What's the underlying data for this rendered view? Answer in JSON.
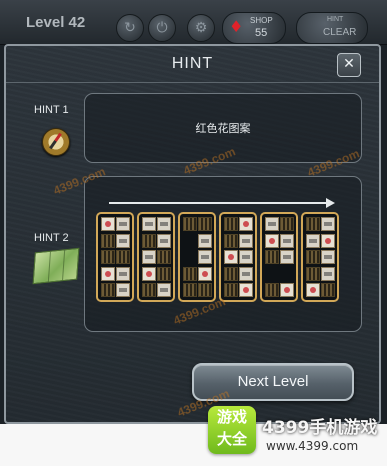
{
  "topbar": {
    "level_label": "Level 42",
    "shop_label": "SHOP",
    "shop_count": "55",
    "clear_top": "HINT",
    "clear_bottom": "CLEAR"
  },
  "dialog": {
    "title": "HINT",
    "close_glyph": "✕",
    "hint1": {
      "label": "HINT 1",
      "icon": "compass-icon",
      "text": "红色花图案"
    },
    "hint2": {
      "label": "HINT 2",
      "icon": "map-icon"
    },
    "next_button": "Next Level"
  },
  "footer": {
    "logo_line1": "游戏",
    "logo_line2": "大全",
    "brand": "4399手机游戏",
    "url": "www.4399.com"
  },
  "watermark": "4399.com",
  "colors": {
    "accent": "#d2a858",
    "flower": "#c8333a",
    "gem": "#e0222a"
  }
}
